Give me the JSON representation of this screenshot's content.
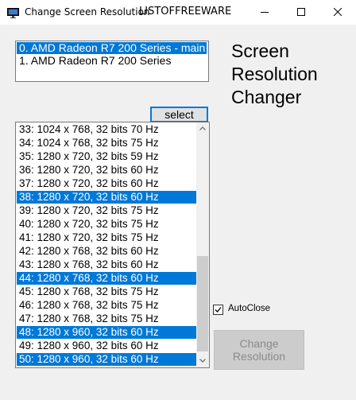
{
  "window": {
    "title": "Change Screen Resolution",
    "brand": "LISTOFFREEWARE",
    "icons": {
      "app": "monitor-icon",
      "minimize": "minimize-icon",
      "maximize": "maximize-icon",
      "close": "close-icon"
    }
  },
  "adapters": {
    "items": [
      {
        "label": "0. AMD Radeon R7 200 Series - main",
        "selected": true
      },
      {
        "label": "1. AMD Radeon R7 200 Series",
        "selected": false
      }
    ]
  },
  "heading": {
    "lines": [
      "Screen",
      "Resolution",
      "Changer"
    ]
  },
  "select_button": {
    "label": "select"
  },
  "modes": {
    "items": [
      {
        "label": "33: 1024 x 768, 32 bits 70 Hz",
        "selected": false
      },
      {
        "label": "34: 1024 x 768, 32 bits 75 Hz",
        "selected": false
      },
      {
        "label": "35: 1280 x 720, 32 bits 59 Hz",
        "selected": false
      },
      {
        "label": "36: 1280 x 720, 32 bits 60 Hz",
        "selected": false
      },
      {
        "label": "37: 1280 x 720, 32 bits 60 Hz",
        "selected": false
      },
      {
        "label": "38: 1280 x 720, 32 bits 60 Hz",
        "selected": true
      },
      {
        "label": "39: 1280 x 720, 32 bits 75 Hz",
        "selected": false
      },
      {
        "label": "40: 1280 x 720, 32 bits 75 Hz",
        "selected": false
      },
      {
        "label": "41: 1280 x 720, 32 bits 75 Hz",
        "selected": false
      },
      {
        "label": "42: 1280 x 768, 32 bits 60 Hz",
        "selected": false
      },
      {
        "label": "43: 1280 x 768, 32 bits 60 Hz",
        "selected": false
      },
      {
        "label": "44: 1280 x 768, 32 bits 60 Hz",
        "selected": true
      },
      {
        "label": "45: 1280 x 768, 32 bits 75 Hz",
        "selected": false
      },
      {
        "label": "46: 1280 x 768, 32 bits 75 Hz",
        "selected": false
      },
      {
        "label": "47: 1280 x 768, 32 bits 75 Hz",
        "selected": false
      },
      {
        "label": "48: 1280 x 960, 32 bits 60 Hz",
        "selected": true
      },
      {
        "label": "49: 1280 x 960, 32 bits 60 Hz",
        "selected": false
      },
      {
        "label": "50: 1280 x 960, 32 bits 60 Hz",
        "selected": true
      }
    ],
    "scrollbar_icons": {
      "up": "chevron-up-icon",
      "down": "chevron-down-icon"
    }
  },
  "autoclose": {
    "label": "AutoClose",
    "checked": true
  },
  "change_button": {
    "line1": "Change",
    "line2": "Resolution",
    "enabled": false
  },
  "colors": {
    "selection": "#0078d7",
    "window_bg": "#f0f0f0",
    "disabled_text": "#8a8a8a"
  }
}
